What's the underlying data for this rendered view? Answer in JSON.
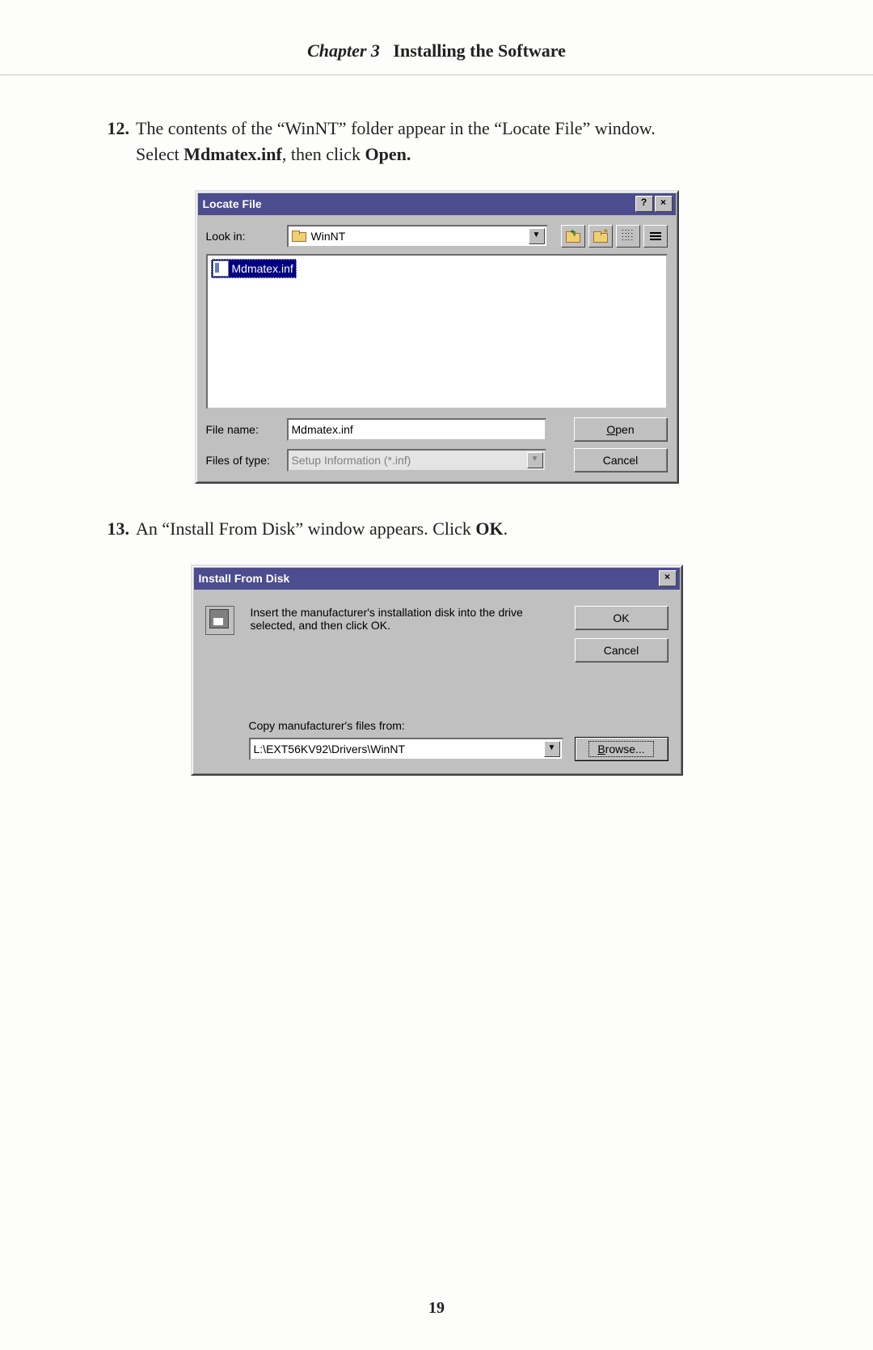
{
  "chapter": {
    "label": "Chapter 3",
    "title": "Installing the Software"
  },
  "steps": {
    "s12": {
      "num": "12.",
      "line1_a": "The contents of the “WinNT” folder appear in the “Locate File” window.",
      "line2_a": "Select ",
      "line2_b": "Mdmatex.inf",
      "line2_c": ", then click ",
      "line2_d": "Open."
    },
    "s13": {
      "num": "13.",
      "line_a": "An “Install From Disk” window appears. Click ",
      "line_b": "OK",
      "line_c": "."
    }
  },
  "locate": {
    "title": "Locate File",
    "help": "?",
    "close": "×",
    "lookin_label": "Look in:",
    "lookin_value": "WinNT",
    "file_selected": "Mdmatex.inf",
    "filename_label": "File name:",
    "filename_value": "Mdmatex.inf",
    "filetype_label": "Files of type:",
    "filetype_value": "Setup Information (*.inf)",
    "open": "Open",
    "cancel": "Cancel"
  },
  "install": {
    "title": "Install From Disk",
    "close": "×",
    "message": "Insert the manufacturer's installation disk into the drive selected, and then click OK.",
    "copy_label": "Copy manufacturer's files from:",
    "path": "L:\\EXT56KV92\\Drivers\\WinNT",
    "ok": "OK",
    "cancel": "Cancel",
    "browse": "Browse..."
  },
  "page_number": "19"
}
